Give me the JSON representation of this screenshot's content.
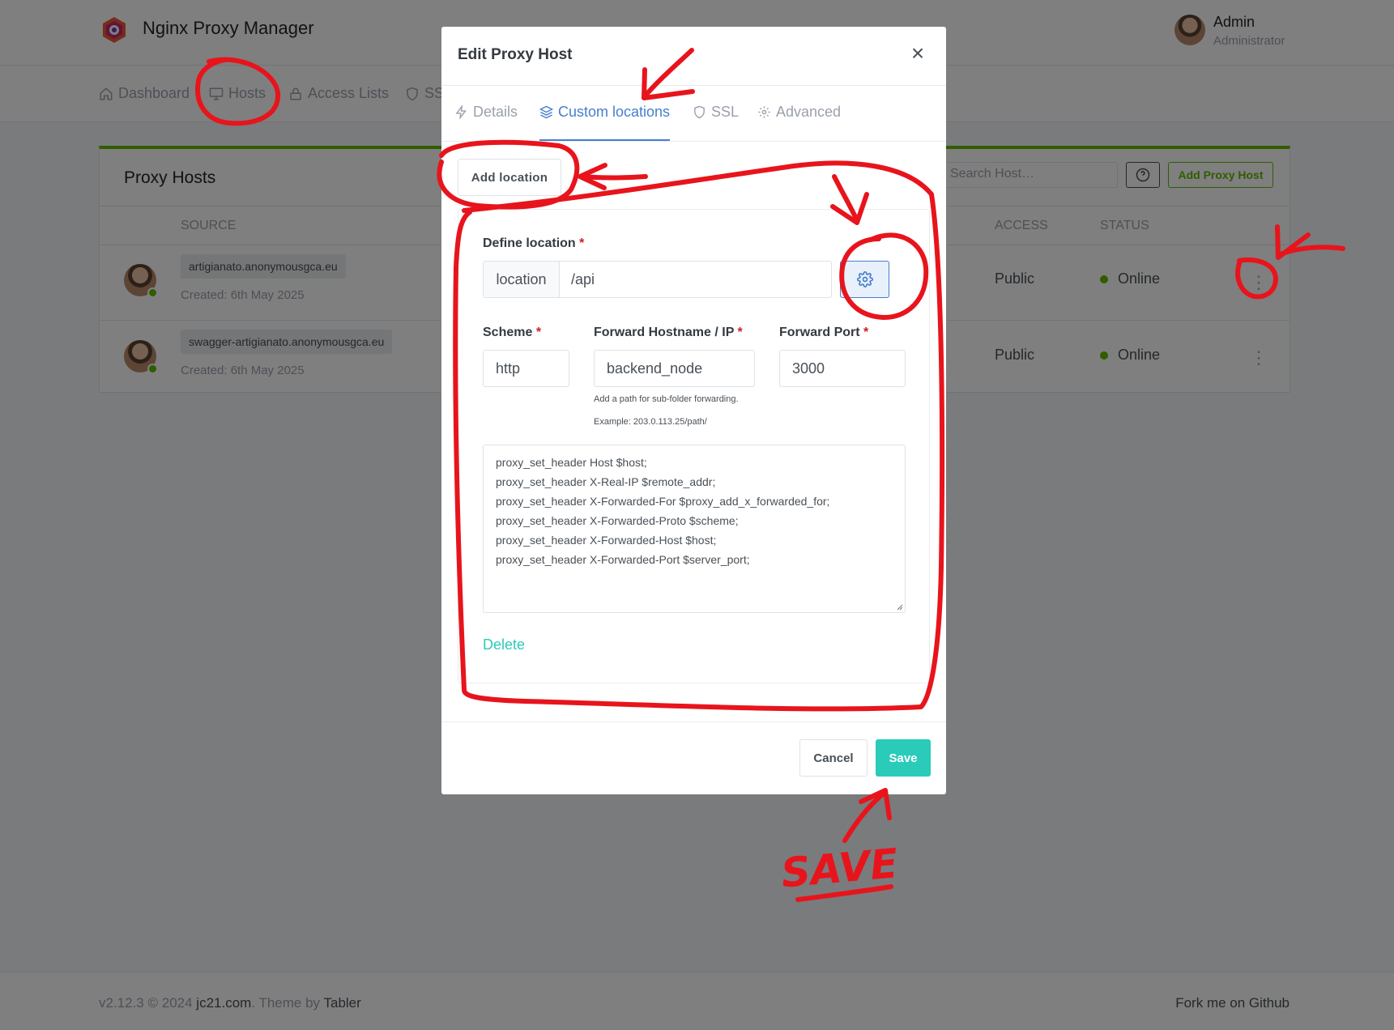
{
  "app": {
    "name": "Nginx Proxy Manager"
  },
  "user": {
    "name": "Admin",
    "role": "Administrator"
  },
  "nav": [
    {
      "label": "Dashboard",
      "icon": "home-icon"
    },
    {
      "label": "Hosts",
      "icon": "monitor-icon"
    },
    {
      "label": "Access Lists",
      "icon": "lock-icon"
    },
    {
      "label": "SSL",
      "icon": "shield-icon"
    }
  ],
  "card": {
    "title": "Proxy Hosts",
    "search_placeholder": "Search Host…",
    "add_button": "Add Proxy Host",
    "columns": {
      "source": "SOURCE",
      "access": "ACCESS",
      "status": "STATUS"
    },
    "rows": [
      {
        "host": "artigianato.anonymousgca.eu",
        "created": "Created: 6th May 2025",
        "access": "Public",
        "status": "Online"
      },
      {
        "host": "swagger-artigianato.anonymousgca.eu",
        "created": "Created: 6th May 2025",
        "access": "Public",
        "status": "Online"
      }
    ]
  },
  "footer": {
    "version": "v2.12.3 © 2024",
    "link": "jc21.com",
    "theme_text": ". Theme by",
    "theme": "Tabler",
    "right": "Fork me on Github"
  },
  "modal": {
    "title": "Edit Proxy Host",
    "tabs": [
      {
        "label": "Details",
        "icon": "bolt-icon"
      },
      {
        "label": "Custom locations",
        "icon": "layers-icon",
        "active": true
      },
      {
        "label": "SSL",
        "icon": "shield-icon"
      },
      {
        "label": "Advanced",
        "icon": "gear-icon"
      }
    ],
    "add_location": "Add location",
    "location": {
      "define_label": "Define location",
      "prefix": "location",
      "path": "/api",
      "scheme_label": "Scheme",
      "scheme": "http",
      "hostname_label": "Forward Hostname / IP",
      "hostname": "backend_node",
      "port_label": "Forward Port",
      "port": "3000",
      "hint1": "Add a path for sub-folder forwarding.",
      "hint2": "Example: 203.0.113.25/path/",
      "config_lines": [
        "proxy_set_header Host $host;",
        "proxy_set_header X-Real-IP $remote_addr;",
        "proxy_set_header X-Forwarded-For $proxy_add_x_forwarded_for;",
        "proxy_set_header X-Forwarded-Proto $scheme;",
        "proxy_set_header X-Forwarded-Host $host;",
        "proxy_set_header X-Forwarded-Port $server_port;"
      ],
      "delete": "Delete"
    },
    "cancel": "Cancel",
    "save": "Save"
  },
  "annotation": {
    "text": "SAVE",
    "color": "#e8141c"
  },
  "colors": {
    "accent": "#467fcf",
    "teal": "#2bcbba",
    "green": "#5eba00"
  }
}
